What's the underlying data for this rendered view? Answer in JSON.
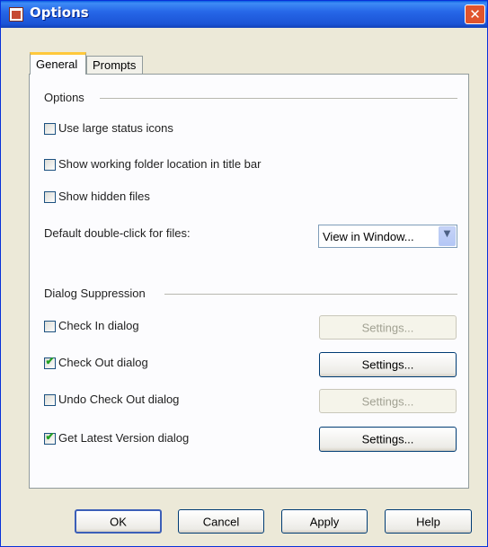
{
  "window": {
    "title": "Options",
    "close_glyph": "✕"
  },
  "tabs": [
    {
      "label": "General",
      "selected": true
    },
    {
      "label": "Prompts",
      "selected": false
    }
  ],
  "options_section": {
    "title": "Options",
    "checkboxes": [
      {
        "label": "Use large status icons",
        "checked": false
      },
      {
        "label": "Show working folder location in title bar",
        "checked": false
      },
      {
        "label": "Show hidden files",
        "checked": false
      }
    ],
    "double_click": {
      "label": "Default double-click for files:",
      "value": "View in Window...",
      "arrow_glyph": "▼"
    }
  },
  "dialog_section": {
    "title": "Dialog Suppression",
    "rows": [
      {
        "label": "Check In dialog",
        "checked": false,
        "button": "Settings...",
        "button_enabled": false
      },
      {
        "label": "Check Out dialog",
        "checked": true,
        "button": "Settings...",
        "button_enabled": true
      },
      {
        "label": "Undo Check Out dialog",
        "checked": false,
        "button": "Settings...",
        "button_enabled": false
      },
      {
        "label": "Get Latest Version dialog",
        "checked": true,
        "button": "Settings...",
        "button_enabled": true
      }
    ]
  },
  "check_glyph": "✔",
  "footer": {
    "ok": "OK",
    "cancel": "Cancel",
    "apply": "Apply",
    "help": "Help"
  },
  "colors": {
    "titlebar": "#2667e8",
    "dialog_bg": "#ece9d8",
    "check": "#21a121",
    "tab_highlight": "#ffc83c"
  }
}
